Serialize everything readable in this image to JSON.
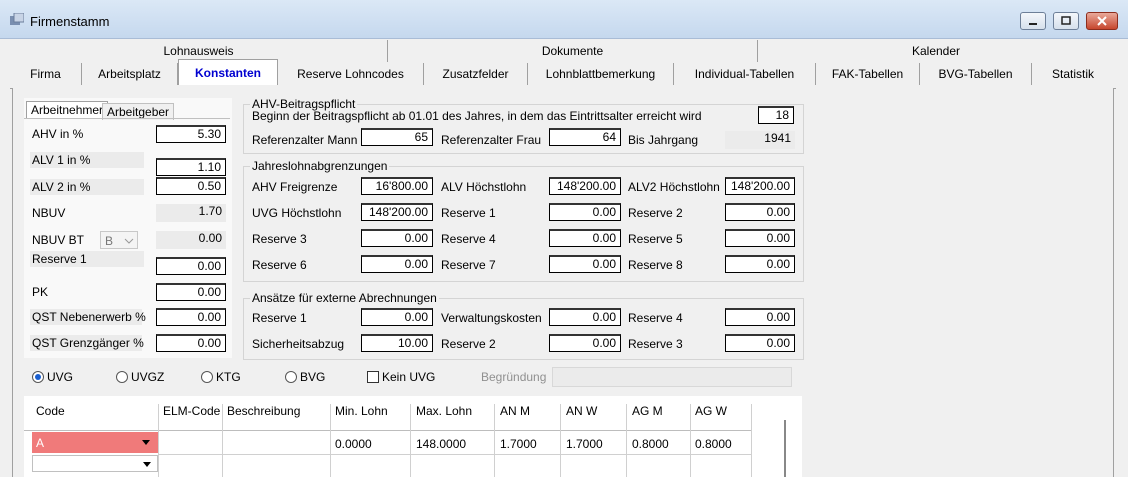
{
  "window": {
    "title": "Firmenstamm"
  },
  "tabs_row1": [
    "Lohnausweis",
    "Dokumente",
    "Kalender"
  ],
  "tabs_row2": [
    "Firma",
    "Arbeitsplatz",
    "Konstanten",
    "Reserve Lohncodes",
    "Zusatzfelder",
    "Lohnblattbemerkung",
    "Individual-Tabellen",
    "FAK-Tabellen",
    "BVG-Tabellen",
    "Statistik"
  ],
  "active_tab": "Konstanten",
  "subtabs": [
    "Arbeitnehmer",
    "Arbeitgeber"
  ],
  "left": [
    {
      "label": "AHV in %",
      "value": "5.30"
    },
    {
      "label": "ALV 1 in %",
      "value": "1.10"
    },
    {
      "label": "ALV 2 in %",
      "value": "0.50"
    },
    {
      "label": "NBUV",
      "value": "1.70"
    },
    {
      "label": "NBUV BT",
      "select": "B",
      "value": "0.00"
    },
    {
      "label": "Reserve 1",
      "value": "0.00"
    },
    {
      "label": "PK",
      "value": "0.00"
    },
    {
      "label": "QST Nebenerwerb %",
      "value": "0.00"
    },
    {
      "label": "QST Grenzgänger %",
      "value": "0.00"
    }
  ],
  "ahv": {
    "group": "AHV-Beitragspflicht",
    "beginn_label": "Beginn der Beitragspflicht ab 01.01 des Jahres, in dem das Eintrittsalter erreicht wird",
    "beginn_value": "18",
    "ref_mann_label": "Referenzalter Mann",
    "ref_mann_value": "65",
    "ref_frau_label": "Referenzalter Frau",
    "ref_frau_value": "64",
    "jahrgang_label": "Bis Jahrgang",
    "jahrgang_value": "1941"
  },
  "jahres": {
    "group": "Jahreslohnabgrenzungen",
    "rows": [
      [
        {
          "label": "AHV Freigrenze",
          "value": "16'800.00"
        },
        {
          "label": "ALV Höchstlohn",
          "value": "148'200.00"
        },
        {
          "label": "ALV2 Höchstlohn",
          "value": "148'200.00"
        }
      ],
      [
        {
          "label": "UVG Höchstlohn",
          "value": "148'200.00"
        },
        {
          "label": "Reserve 1",
          "value": "0.00"
        },
        {
          "label": "Reserve 2",
          "value": "0.00"
        }
      ],
      [
        {
          "label": "Reserve 3",
          "value": "0.00"
        },
        {
          "label": "Reserve 4",
          "value": "0.00"
        },
        {
          "label": "Reserve 5",
          "value": "0.00"
        }
      ],
      [
        {
          "label": "Reserve 6",
          "value": "0.00"
        },
        {
          "label": "Reserve 7",
          "value": "0.00"
        },
        {
          "label": "Reserve 8",
          "value": "0.00"
        }
      ]
    ]
  },
  "extern": {
    "group": "Ansätze für externe Abrechnungen",
    "rows": [
      [
        {
          "label": "Reserve 1",
          "value": "0.00"
        },
        {
          "label": "Verwaltungskosten",
          "value": "0.00"
        },
        {
          "label": "Reserve 4",
          "value": "0.00"
        }
      ],
      [
        {
          "label": "Sicherheitsabzug",
          "value": "10.00"
        },
        {
          "label": "Reserve 2",
          "value": "0.00"
        },
        {
          "label": "Reserve 3",
          "value": "0.00"
        }
      ]
    ]
  },
  "radios": [
    "UVG",
    "UVGZ",
    "KTG",
    "BVG"
  ],
  "radio_selected": "UVG",
  "kein_uvg": "Kein UVG",
  "begruendung": {
    "label": "Begründung",
    "value": ""
  },
  "grid": {
    "columns": [
      "Code",
      "ELM-Code",
      "Beschreibung",
      "Min. Lohn",
      "Max. Lohn",
      "AN M",
      "AN W",
      "AG M",
      "AG W"
    ],
    "rows": [
      [
        "A",
        "",
        "",
        "0.0000",
        "148.0000",
        "1.7000",
        "1.7000",
        "0.8000",
        "0.8000"
      ],
      [
        "",
        "",
        "",
        "",
        "",
        "",
        "",
        "",
        ""
      ]
    ]
  },
  "colors": {
    "selected_cell": "#f07a7a",
    "active_tab_text": "#0000d0"
  }
}
